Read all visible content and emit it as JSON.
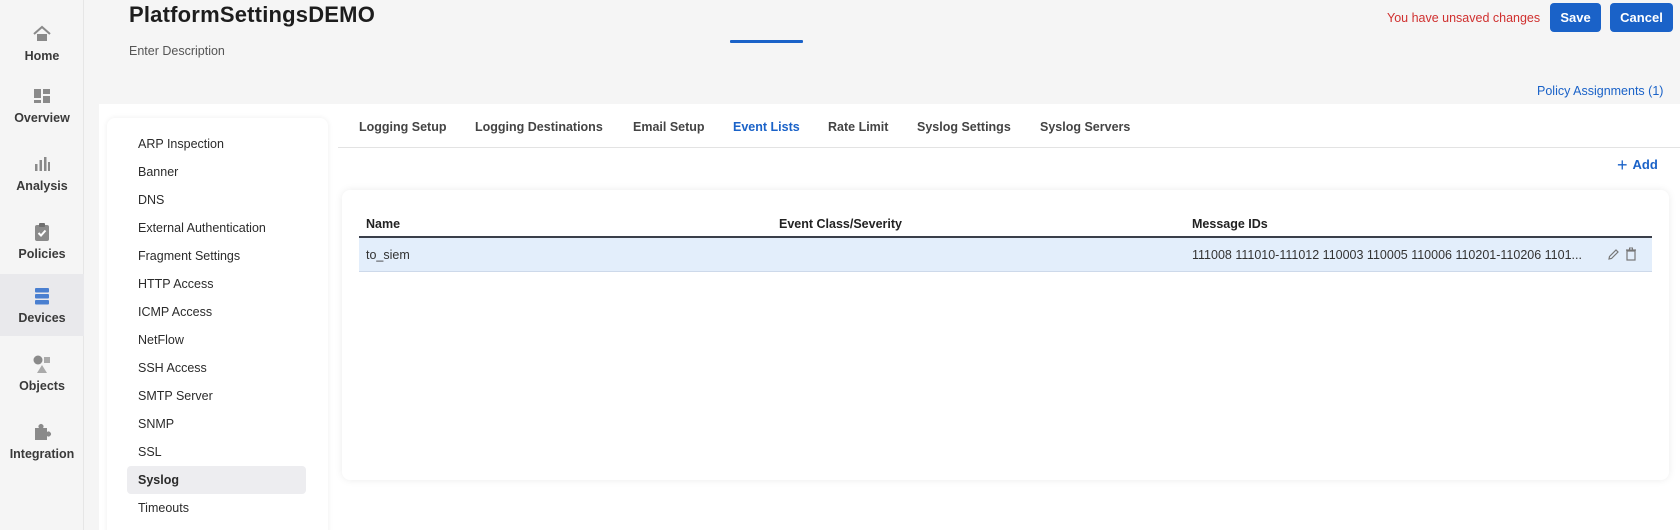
{
  "nav": [
    {
      "label": "Home",
      "icon": "home-icon"
    },
    {
      "label": "Overview",
      "icon": "dashboard-icon"
    },
    {
      "label": "Analysis",
      "icon": "bar-chart-icon"
    },
    {
      "label": "Policies",
      "icon": "clipboard-check-icon"
    },
    {
      "label": "Devices",
      "icon": "server-icon"
    },
    {
      "label": "Objects",
      "icon": "shapes-icon"
    },
    {
      "label": "Integration",
      "icon": "puzzle-icon"
    }
  ],
  "header": {
    "title": "PlatformSettingsDEMO",
    "description": "Enter Description",
    "unsaved": "You have unsaved changes",
    "save_label": "Save",
    "cancel_label": "Cancel",
    "assignments": "Policy Assignments (1)"
  },
  "settings": {
    "items": [
      "ARP Inspection",
      "Banner",
      "DNS",
      "External Authentication",
      "Fragment Settings",
      "HTTP Access",
      "ICMP Access",
      "NetFlow",
      "SSH Access",
      "SMTP Server",
      "SNMP",
      "SSL",
      "Syslog",
      "Timeouts"
    ],
    "active": "Syslog"
  },
  "tabs": {
    "items": [
      "Logging Setup",
      "Logging Destinations",
      "Email Setup",
      "Event Lists",
      "Rate Limit",
      "Syslog Settings",
      "Syslog Servers"
    ],
    "active": "Event Lists"
  },
  "add_label": "Add",
  "table": {
    "columns": [
      "Name",
      "Event Class/Severity",
      "Message IDs"
    ],
    "rows": [
      {
        "name": "to_siem",
        "event_class": "",
        "message_ids": "111008 111010-111012 110003 110005 110006 110201-110206 1101..."
      }
    ]
  },
  "colors": {
    "accent": "#1a62c8",
    "warning_text": "#d0302f",
    "selected_row": "#e3eefb"
  }
}
